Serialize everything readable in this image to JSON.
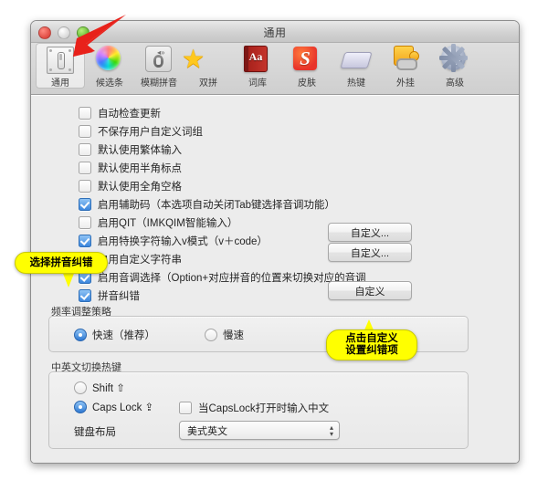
{
  "window": {
    "title": "通用",
    "traffic": {
      "close": "close-button",
      "minimize": "minimize-button",
      "zoom": "zoom-button"
    }
  },
  "toolbar": {
    "items": [
      {
        "label": "通用",
        "icon": "general-icon",
        "selected": true
      },
      {
        "label": "候选条",
        "icon": "color-wheel-icon",
        "selected": false
      },
      {
        "label": "模糊拼音",
        "icon": "fuzzy-pinyin-icon",
        "selected": false
      },
      {
        "label": "双拼",
        "icon": "star-icon",
        "selected": false
      },
      {
        "label": "词库",
        "icon": "dictionary-icon",
        "selected": false
      },
      {
        "label": "皮肤",
        "icon": "skin-icon",
        "selected": false
      },
      {
        "label": "热键",
        "icon": "hotkey-icon",
        "selected": false
      },
      {
        "label": "外挂",
        "icon": "plugin-icon",
        "selected": false
      },
      {
        "label": "高级",
        "icon": "gear-icon",
        "selected": false
      }
    ]
  },
  "checkboxes": [
    {
      "label": "自动检查更新",
      "checked": false
    },
    {
      "label": "不保存用户自定义词组",
      "checked": false
    },
    {
      "label": "默认使用繁体输入",
      "checked": false
    },
    {
      "label": "默认使用半角标点",
      "checked": false
    },
    {
      "label": "默认使用全角空格",
      "checked": false
    },
    {
      "label": "启用辅助码（本选项自动关闭Tab键选择音调功能）",
      "checked": true
    },
    {
      "label": "启用QIT（IMKQIM智能输入）",
      "checked": false
    },
    {
      "label": "启用特换字符输入v模式（v＋code）",
      "checked": true
    },
    {
      "label": "启用自定义字符串",
      "checked": true
    },
    {
      "label": "启用音调选择（Option+对应拼音的位置来切换对应的音调",
      "checked": true
    },
    {
      "label": "拼音纠错",
      "checked": true
    }
  ],
  "buttons": {
    "custom_v_mode": "自定义...",
    "custom_string": "自定义...",
    "custom_correction": "自定义"
  },
  "frequency_group": {
    "title": "频率调整策略",
    "options": [
      {
        "label": "快速（推荐）",
        "selected": true
      },
      {
        "label": "慢速",
        "selected": false
      }
    ]
  },
  "hotkey_group": {
    "title": "中英文切换热键",
    "options": [
      {
        "label": "Shift ⇧",
        "selected": false
      },
      {
        "label": "Caps Lock ⇪",
        "selected": true
      }
    ],
    "capslock_checkbox": {
      "label": "当CapsLock打开时输入中文",
      "checked": false
    },
    "keyboard_layout_label": "键盘布局",
    "keyboard_layout_value": "美式英文"
  },
  "annotations": {
    "callout_left": "选择拼音纠错",
    "callout_right_line1": "点击自定义",
    "callout_right_line2": "设置纠错项",
    "arrow_color": "#e8211a",
    "callout_color": "#ffff00"
  }
}
